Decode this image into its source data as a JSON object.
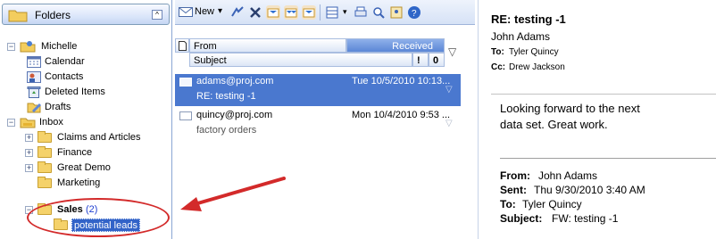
{
  "folders": {
    "title": "Folders",
    "collapse": "^",
    "account": "Michelle",
    "items": [
      "Calendar",
      "Contacts",
      "Deleted Items",
      "Drafts",
      "Inbox",
      "Claims and Articles",
      "Finance",
      "Great Demo",
      "Marketing"
    ],
    "sales_label": "Sales",
    "sales_count": "(2)",
    "subfolder": "potential leads"
  },
  "toolbar": {
    "new_label": "New",
    "dropdown_glyph": "▾"
  },
  "list": {
    "col_from": "From",
    "col_received": "Received",
    "col_subject": "Subject",
    "col_importance": "!",
    "col_attach": "0",
    "messages": [
      {
        "from": "adams@proj.com",
        "date": "Tue 10/5/2010 10:13...",
        "subject": "RE: testing -1"
      },
      {
        "from": "quincy@proj.com",
        "date": "Mon 10/4/2010 9:53 ...",
        "subject": "factory orders"
      }
    ]
  },
  "reading": {
    "subject": "RE: testing -1",
    "sender": "John Adams",
    "to_label": "To:",
    "to": "Tyler Quincy",
    "cc_label": "Cc:",
    "cc": "Drew Jackson",
    "body_line1": "Looking forward to the next",
    "body_line2": "data set. Great work.",
    "from_label": "From:",
    "from_value": "John Adams",
    "sent_label": "Sent:",
    "sent_value": "Thu 9/30/2010 3:40 AM",
    "to2_label": "To:",
    "to2_value": "Tyler Quincy",
    "subj2_label": "Subject:",
    "subj2_value": "FW: testing -1"
  },
  "colors": {
    "selection": "#4a78cf",
    "annotation": "#d32a2a",
    "sales_count": "#1f3fd1"
  }
}
